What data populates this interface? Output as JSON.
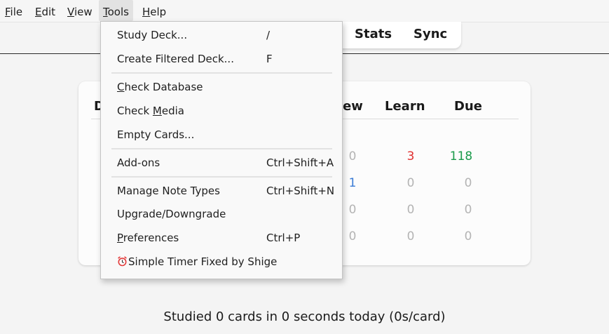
{
  "menubar": {
    "items": [
      {
        "accel": "F",
        "rest": "ile"
      },
      {
        "accel": "E",
        "rest": "dit"
      },
      {
        "accel": "V",
        "rest": "iew"
      },
      {
        "accel": "T",
        "rest": "ools"
      },
      {
        "accel": "H",
        "rest": "elp"
      }
    ]
  },
  "toolbar": {
    "stats_label": "Stats",
    "sync_label": "Sync"
  },
  "deck_table": {
    "headers": {
      "deck_partial": "D",
      "new_partial": "New",
      "learn": "Learn",
      "due": "Due"
    },
    "rows": [
      {
        "new": "0",
        "learn": "3",
        "due": "118"
      },
      {
        "new": "1",
        "learn": "0",
        "due": "0"
      },
      {
        "new": "0",
        "learn": "0",
        "due": "0"
      },
      {
        "new": "0",
        "learn": "0",
        "due": "0"
      }
    ]
  },
  "colors": {
    "learn_red": "#e03030",
    "due_green": "#1a9a4a",
    "new_blue": "#3a7bd5",
    "zero_gray": "#b4b4b4"
  },
  "tools_menu": {
    "items": [
      {
        "pre": "",
        "accel": "",
        "post": "Study Deck...",
        "shortcut": "/"
      },
      {
        "pre": "",
        "accel": "",
        "post": "Create Filtered Deck...",
        "shortcut": "F"
      },
      {
        "pre": "",
        "accel": "C",
        "post": "heck Database",
        "shortcut": ""
      },
      {
        "pre": "Check ",
        "accel": "M",
        "post": "edia",
        "shortcut": ""
      },
      {
        "pre": "",
        "accel": "",
        "post": "Empty Cards...",
        "shortcut": ""
      },
      {
        "pre": "",
        "accel": "",
        "post": "Add-ons",
        "shortcut": "Ctrl+Shift+A"
      },
      {
        "pre": "",
        "accel": "",
        "post": "Manage Note Types",
        "shortcut": "Ctrl+Shift+N"
      },
      {
        "pre": "",
        "accel": "",
        "post": "Upgrade/Downgrade",
        "shortcut": ""
      },
      {
        "pre": "",
        "accel": "P",
        "post": "references",
        "shortcut": "Ctrl+P"
      },
      {
        "pre": "",
        "accel": "",
        "post": "Simple Timer Fixed by Shige",
        "shortcut": "",
        "icon": "alarm-clock-icon"
      }
    ]
  },
  "footer": {
    "studied_text": "Studied 0 cards in 0 seconds today (0s/card)"
  }
}
